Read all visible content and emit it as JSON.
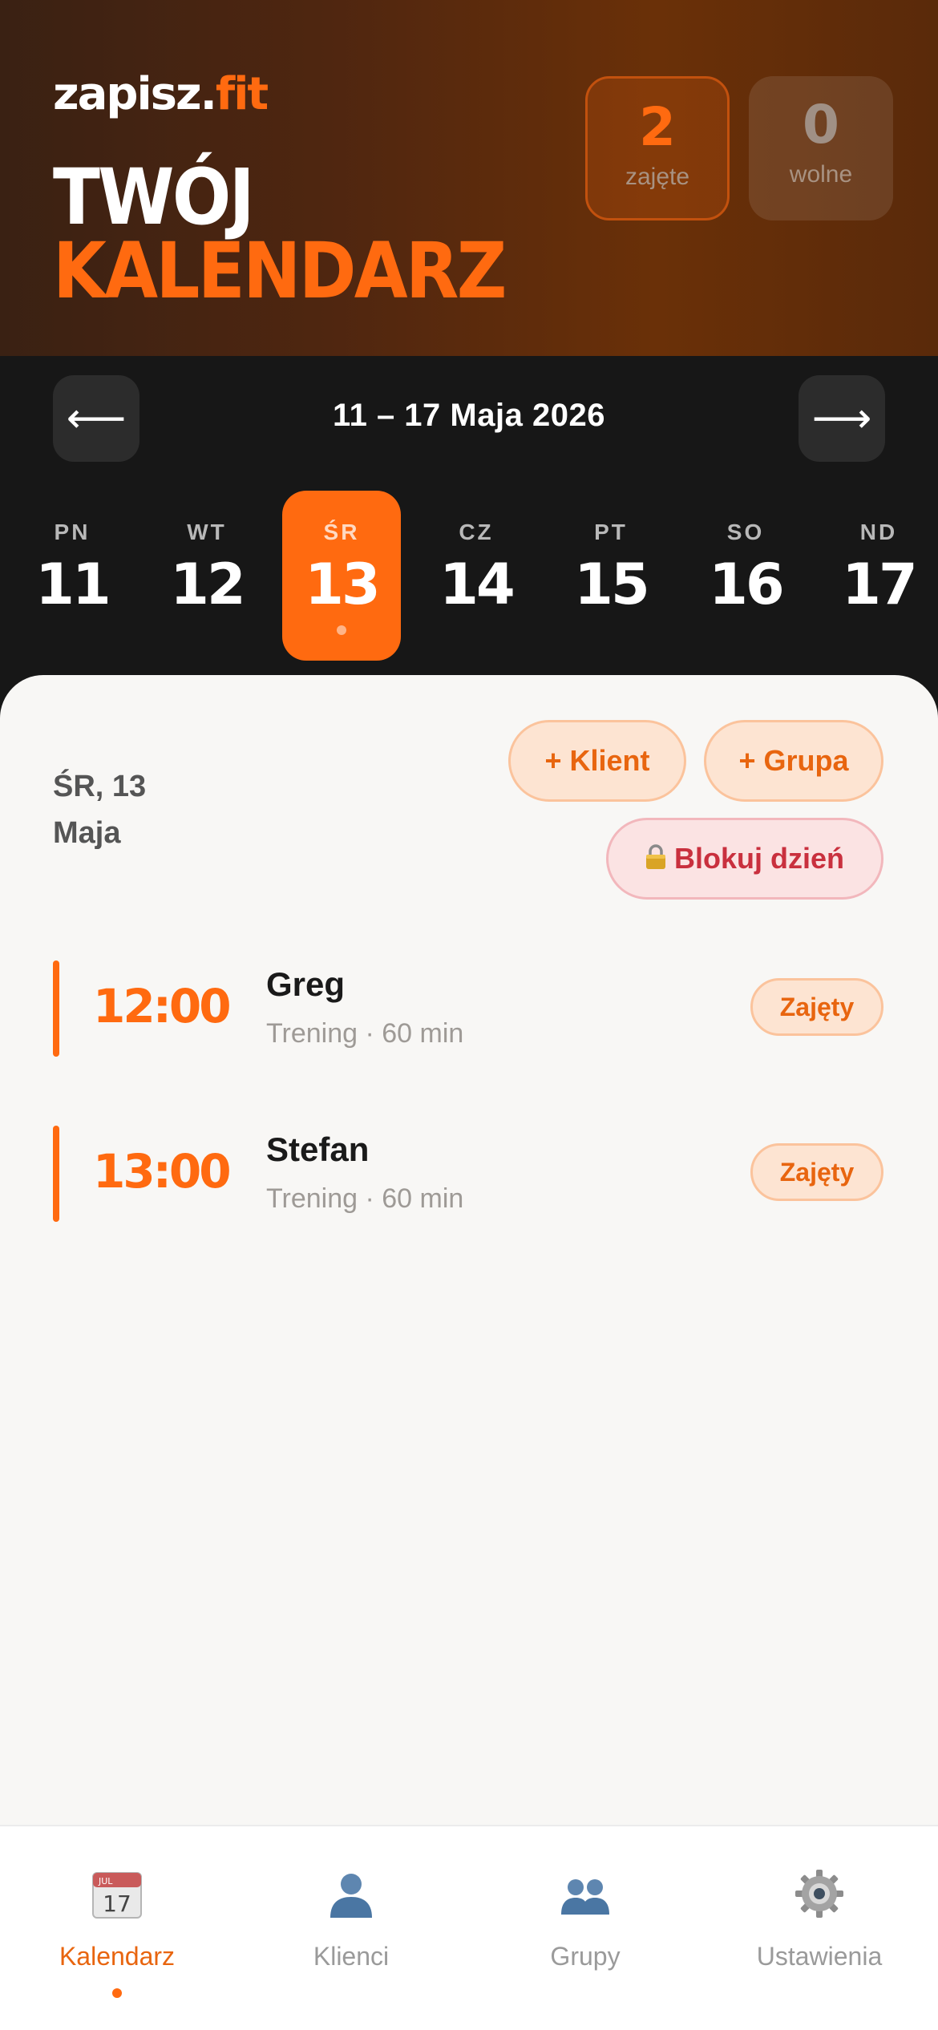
{
  "brand": {
    "name_part1": "zapisz.",
    "name_part2": "fit"
  },
  "header": {
    "title_line1": "TWÓJ",
    "title_line2": "KALENDARZ"
  },
  "stats": {
    "busy": {
      "value": "2",
      "label": "zajęte"
    },
    "free": {
      "value": "0",
      "label": "wolne"
    }
  },
  "week": {
    "prev_label": "⟵",
    "next_label": "⟶",
    "range": "11 – 17 Maja 2026",
    "days": [
      {
        "name": "PN",
        "date": "11"
      },
      {
        "name": "WT",
        "date": "12"
      },
      {
        "name": "ŚR",
        "date": "13"
      },
      {
        "name": "CZ",
        "date": "14"
      },
      {
        "name": "PT",
        "date": "15"
      },
      {
        "name": "SO",
        "date": "16"
      },
      {
        "name": "ND",
        "date": "17"
      }
    ],
    "selected_index": 2
  },
  "selected": {
    "date_line1": "ŚR, 13",
    "date_line2": "Maja"
  },
  "actions": {
    "add_client": "+ Klient",
    "add_group": "+ Grupa",
    "block_day": "Blokuj dzień"
  },
  "appointments": [
    {
      "time": "12:00",
      "name": "Greg",
      "meta": "Trening · 60 min",
      "status": "Zajęty"
    },
    {
      "time": "13:00",
      "name": "Stefan",
      "meta": "Trening · 60 min",
      "status": "Zajęty"
    }
  ],
  "tabs": [
    {
      "label": "Kalendarz",
      "icon": "calendar-icon",
      "active": true
    },
    {
      "label": "Klienci",
      "icon": "person-icon",
      "active": false
    },
    {
      "label": "Grupy",
      "icon": "group-icon",
      "active": false
    },
    {
      "label": "Ustawienia",
      "icon": "gear-icon",
      "active": false
    }
  ],
  "colors": {
    "accent": "#ff6a10",
    "dark": "#171717",
    "sheet": "#f8f7f5",
    "danger": "#c9303e"
  }
}
